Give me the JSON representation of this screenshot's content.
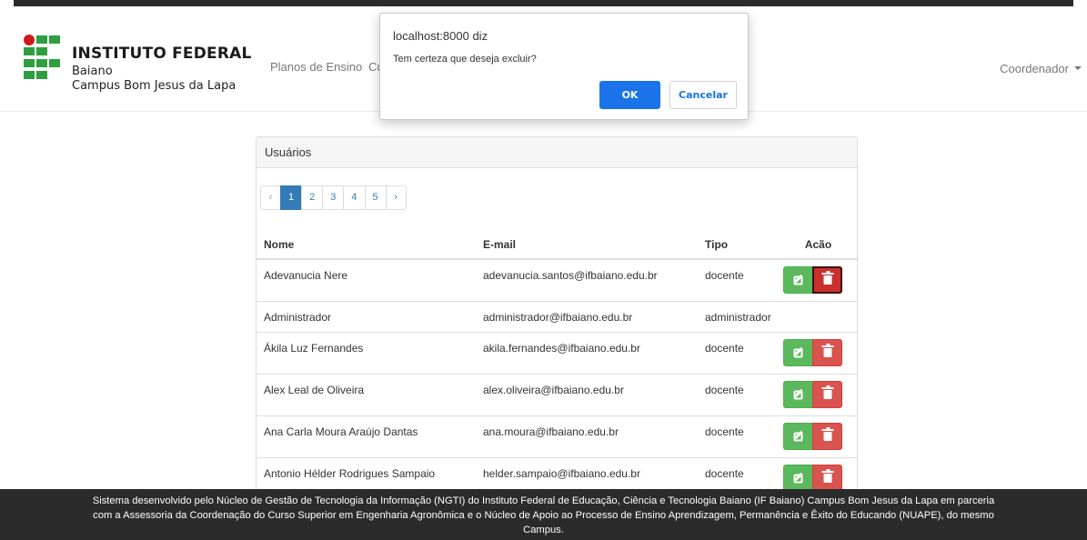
{
  "navbar": {
    "brand_title": "INSTITUTO FEDERAL",
    "brand_line1": "Baiano",
    "brand_line2": "Campus Bom Jesus da Lapa",
    "links": [
      "Planos de Ensino",
      "Cu"
    ],
    "user_menu": "Coordenador"
  },
  "dialog": {
    "title": "localhost:8000 diz",
    "message": "Tem certeza que deseja excluir?",
    "ok_label": "OK",
    "cancel_label": "Cancelar",
    "ok_color": "#1a73e8"
  },
  "panel": {
    "heading": "Usuários",
    "pagination": {
      "prev": "‹",
      "pages": [
        "1",
        "2",
        "3",
        "4",
        "5"
      ],
      "active_page": "1",
      "next": "›"
    },
    "table": {
      "columns": [
        "Nome",
        "E-mail",
        "Tipo",
        "Acão"
      ],
      "rows": [
        {
          "nome": "Adevanucia Nere",
          "email": "adevanucia.santos@ifbaiano.edu.br",
          "tipo": "docente",
          "actions": true,
          "delete_focused": true
        },
        {
          "nome": "Administrador",
          "email": "administrador@ifbaiano.edu.br",
          "tipo": "administrador",
          "actions": false
        },
        {
          "nome": "Ákila Luz Fernandes",
          "email": "akila.fernandes@ifbaiano.edu.br",
          "tipo": "docente",
          "actions": true
        },
        {
          "nome": "Alex Leal de Oliveira",
          "email": "alex.oliveira@ifbaiano.edu.br",
          "tipo": "docente",
          "actions": true
        },
        {
          "nome": "Ana Carla Moura Araújo Dantas",
          "email": "ana.moura@ifbaiano.edu.br",
          "tipo": "docente",
          "actions": true
        },
        {
          "nome": "Antonio Hélder Rodrigues Sampaio",
          "email": "helder.sampaio@ifbaiano.edu.br",
          "tipo": "docente",
          "actions": true
        }
      ]
    }
  },
  "colors": {
    "edit_button": "#5cb85c",
    "delete_button": "#d9534f",
    "active_page": "#337ab7",
    "footer_bg": "#2b2b2b"
  },
  "icons": {
    "edit": "edit-icon",
    "delete": "trash-icon"
  },
  "footer": {
    "text": "Sistema desenvolvido pelo Núcleo de Gestão de Tecnologia da Informação (NGTI) do Instituto Federal de Educação, Ciência e Tecnologia Baiano (IF Baiano) Campus Bom Jesus da Lapa em parceria com a Assessoria da Coordenação do Curso Superior em Engenharia Agronômica e o Núcleo de Apoio ao Processo de Ensino Aprendizagem, Permanência e Êxito do Educando (NUAPE), do mesmo Campus."
  }
}
